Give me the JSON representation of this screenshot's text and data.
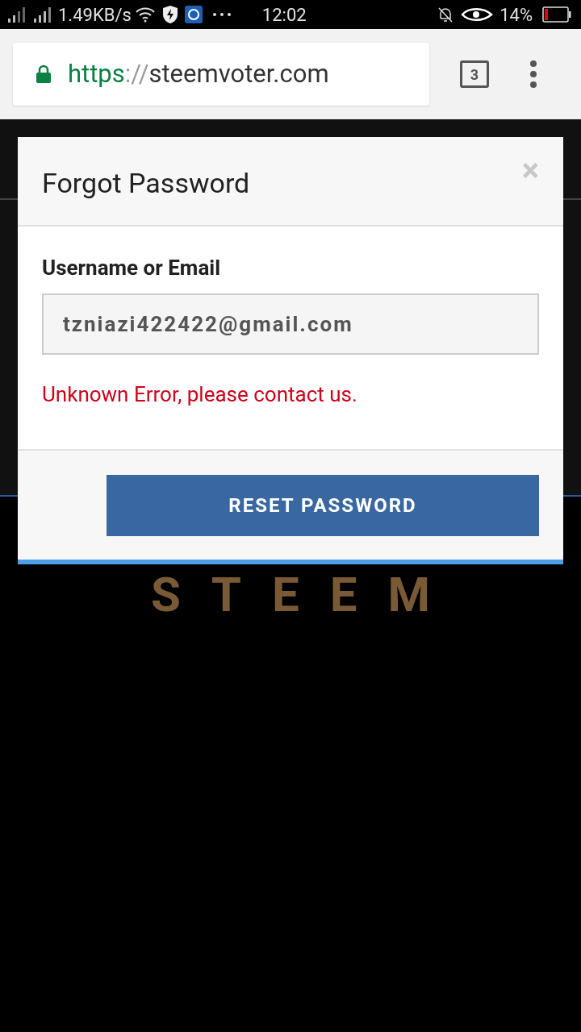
{
  "status_bar": {
    "speed": "1.49KB/s",
    "time": "12:02",
    "battery": "14%"
  },
  "browser": {
    "url_scheme": "https",
    "url_separator": "://",
    "url_host": "steemvoter.com",
    "tab_count": "3"
  },
  "page": {
    "logo_text": "STEEM"
  },
  "dialog": {
    "title": "Forgot Password",
    "close": "×",
    "field_label": "Username or Email",
    "field_value": "tzniazi422422@gmail.com",
    "error": "Unknown Error, please contact us.",
    "button": "RESET PASSWORD"
  }
}
